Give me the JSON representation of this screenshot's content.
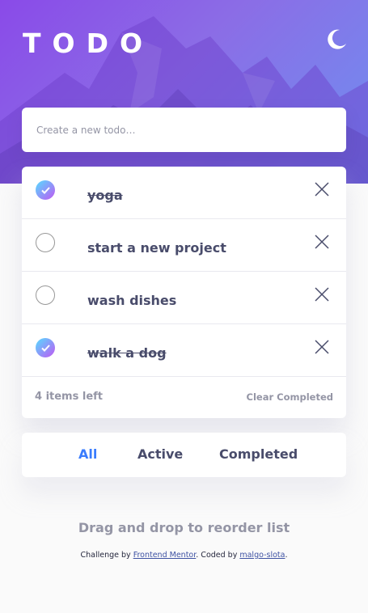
{
  "header": {
    "title": "TODO",
    "theme_icon": "moon-icon"
  },
  "new_todo": {
    "placeholder": "Create a new todo…",
    "value": ""
  },
  "todos": [
    {
      "text": "yoga",
      "completed": true
    },
    {
      "text": "start a new project",
      "completed": false
    },
    {
      "text": "wash dishes",
      "completed": false
    },
    {
      "text": "walk a dog",
      "completed": true
    }
  ],
  "footer": {
    "items_left": "4 items left",
    "clear_label": "Clear Completed"
  },
  "filters": [
    {
      "label": "All",
      "active": true
    },
    {
      "label": "Active",
      "active": false
    },
    {
      "label": "Completed",
      "active": false
    }
  ],
  "hint": "Drag and drop to reorder list",
  "attribution": {
    "prefix": "Challenge by ",
    "link1": "Frontend Mentor",
    "middle": ". Coded by ",
    "link2": "malgo-slota",
    "suffix": "."
  },
  "colors": {
    "accent": "#3a7cfd",
    "check_gradient_start": "#55ddff",
    "check_gradient_end": "#c058f3",
    "text": "#494c6b",
    "muted": "#9495a5"
  }
}
